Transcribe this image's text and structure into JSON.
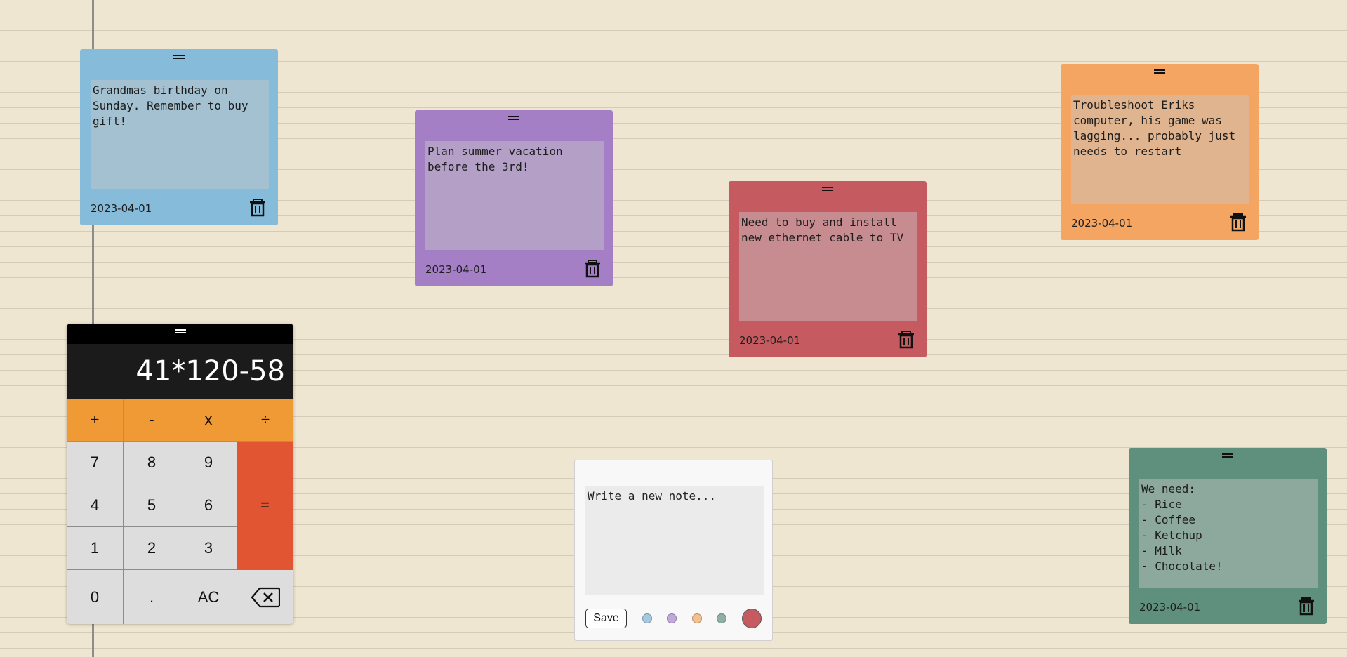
{
  "colors": {
    "background": "#efe6d1",
    "note_blue": "#86bcd9",
    "note_purple": "#a57fc6",
    "note_red": "#c55b61",
    "note_orange": "#f4a561",
    "note_green": "#5e907d",
    "calc_operator": "#ef9a35",
    "calc_equals": "#e15533",
    "calc_display": "#1b1b1b"
  },
  "notes": [
    {
      "text": "Grandmas birthday on Sunday. Remember to buy gift!",
      "date": "2023-04-01",
      "color": "#86bcd9",
      "icon": "trash-icon"
    },
    {
      "text": "Plan summer vacation before the 3rd!",
      "date": "2023-04-01",
      "color": "#a57fc6",
      "icon": "trash-icon"
    },
    {
      "text": "Need to buy and install new ethernet cable to TV",
      "date": "2023-04-01",
      "color": "#c55b61",
      "icon": "trash-icon"
    },
    {
      "text": "Troubleshoot Eriks computer, his game was lagging... probably just needs to restart",
      "date": "2023-04-01",
      "color": "#f4a561",
      "icon": "trash-icon"
    },
    {
      "text": "We need:\n- Rice\n- Coffee\n- Ketchup\n- Milk\n- Chocolate!",
      "date": "2023-04-01",
      "color": "#5e907d",
      "icon": "trash-icon"
    }
  ],
  "calculator": {
    "display": "41*120-58",
    "buttons": {
      "plus": "+",
      "minus": "-",
      "multiply": "x",
      "divide": "÷",
      "seven": "7",
      "eight": "8",
      "nine": "9",
      "four": "4",
      "five": "5",
      "six": "6",
      "one": "1",
      "two": "2",
      "three": "3",
      "equals": "=",
      "zero": "0",
      "decimal": ".",
      "clear": "AC",
      "backspace_icon": "backspace-icon"
    }
  },
  "composer": {
    "placeholder": "Write a new note...",
    "save_label": "Save",
    "swatches": [
      "#a6c9e0",
      "#c1a9d9",
      "#f3c18f",
      "#8fb0a3",
      "#c55b61"
    ],
    "selected_swatch": "#c55b61"
  }
}
